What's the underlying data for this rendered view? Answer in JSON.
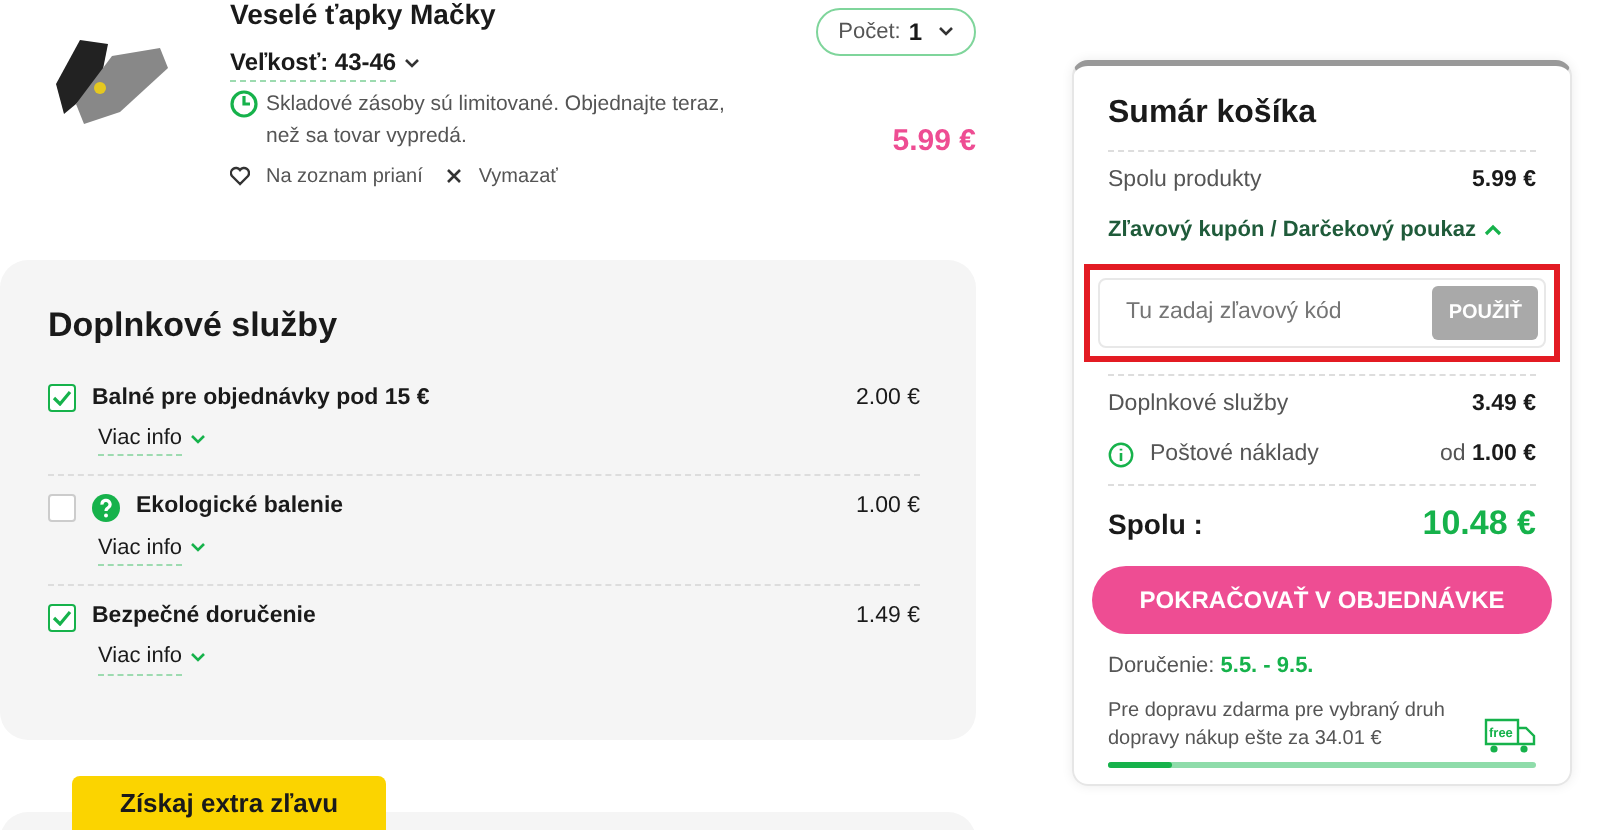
{
  "product": {
    "name": "Veselé ťapky Mačky",
    "size_label": "Veľkosť:",
    "size": "43-46",
    "stock_note": "Skladové zásoby sú limitované. Objednajte teraz, než sa tovar vypredá.",
    "wishlist": "Na zoznam prianí",
    "remove": "Vymazať",
    "quantity_label": "Počet:",
    "quantity": "1",
    "price": "5.99 €"
  },
  "services": {
    "title": "Doplnkové služby",
    "items": [
      {
        "name": "Balné pre objednávky pod 15 €",
        "price": "2.00 €",
        "checked": true,
        "help": false,
        "more": "Viac info"
      },
      {
        "name": "Ekologické balenie",
        "price": "1.00 €",
        "checked": false,
        "help": true,
        "more": "Viac info"
      },
      {
        "name": "Bezpečné doručenie",
        "price": "1.49 €",
        "checked": true,
        "help": false,
        "more": "Viac info"
      }
    ]
  },
  "promo_tab": "Získaj extra zľavu",
  "summary": {
    "title": "Sumár košíka",
    "products_label": "Spolu produkty",
    "products_value": "5.99 €",
    "coupon_toggle": "Zľavový kupón / Darčekový poukaz",
    "coupon_expanded": true,
    "coupon_placeholder": "Tu zadaj zľavový kód",
    "coupon_button": "POUŽIŤ",
    "services_label": "Doplnkové služby",
    "services_value": "3.49 €",
    "shipping_label": "Poštové náklady",
    "shipping_prefix": "od",
    "shipping_value": "1.00 €",
    "total_label": "Spolu :",
    "total_value": "10.48 €",
    "checkout": "POKRAČOVAŤ V OBJEDNÁVKE",
    "delivery_label": "Doručenie:",
    "delivery_value": "5.5. - 9.5.",
    "free_note": "Pre dopravu zdarma pre vybraný druh dopravy nákup ešte za 34.01 €",
    "free_badge": "free",
    "level": 0.15
  }
}
